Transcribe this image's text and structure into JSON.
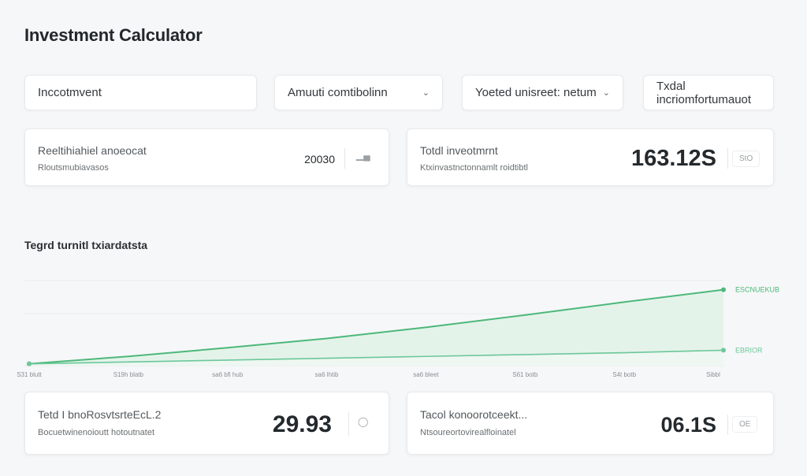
{
  "app": {
    "title": "Investment Calculator"
  },
  "fields": [
    {
      "label": "Inccotmvent",
      "dropdown": false
    },
    {
      "label": "Amuuti comtibolinn",
      "dropdown": true
    },
    {
      "label": "Yoeted unisreet: netum",
      "dropdown": true
    },
    {
      "label": "Txdal incriomfortumauot",
      "dropdown": false
    }
  ],
  "cards": {
    "top_left": {
      "title": "Reeltihiahiel anoeocat",
      "subtitle": "Rloutsmubiavasos",
      "value": "20030",
      "icon": "chart-icon"
    },
    "top_right": {
      "title": "Totdl inveotmrnt",
      "subtitle": "Ktxinvastnctonnamlt roidtibtl",
      "value": "163.12S",
      "badge": "StO"
    },
    "bottom_left": {
      "title": "Tetd I bnoRosvtsrteEcL.2",
      "subtitle": "Bocuetwinenoioutt hotoutnatet",
      "value": "29.93",
      "icon": "coin-icon"
    },
    "bottom_right": {
      "title": "Tacol konoorotceekt...",
      "subtitle": "Ntsoureortovirealfloinatel",
      "value": "06.1S",
      "badge": "OE"
    }
  },
  "section": {
    "title": "Tegrd turnitl txiardatsta"
  },
  "chart_data": {
    "type": "area",
    "x_tick_labels": [
      "S31 blutt",
      "S19h blatb",
      "sa6 bfi hub",
      "sa6 lhtib",
      "sa6 bleet",
      "S61 botb",
      "S4t botb",
      "Sibbl"
    ],
    "series": [
      {
        "name": "ESCNUEKUB",
        "values": [
          0,
          1.2,
          2.6,
          4.1,
          5.9,
          7.9,
          10.0,
          12.0
        ],
        "color": "#4cb87a"
      },
      {
        "name": "EBRIOR",
        "values": [
          0,
          0.3,
          0.6,
          0.9,
          1.2,
          1.5,
          1.8,
          2.2
        ],
        "color": "#6cc79a"
      }
    ],
    "ylim": [
      -0.3,
      14.5
    ],
    "grid": true,
    "fill_color": "#e4f3ea"
  },
  "colors": {
    "accent": "#4cb87a",
    "background": "#f6f7f8"
  }
}
